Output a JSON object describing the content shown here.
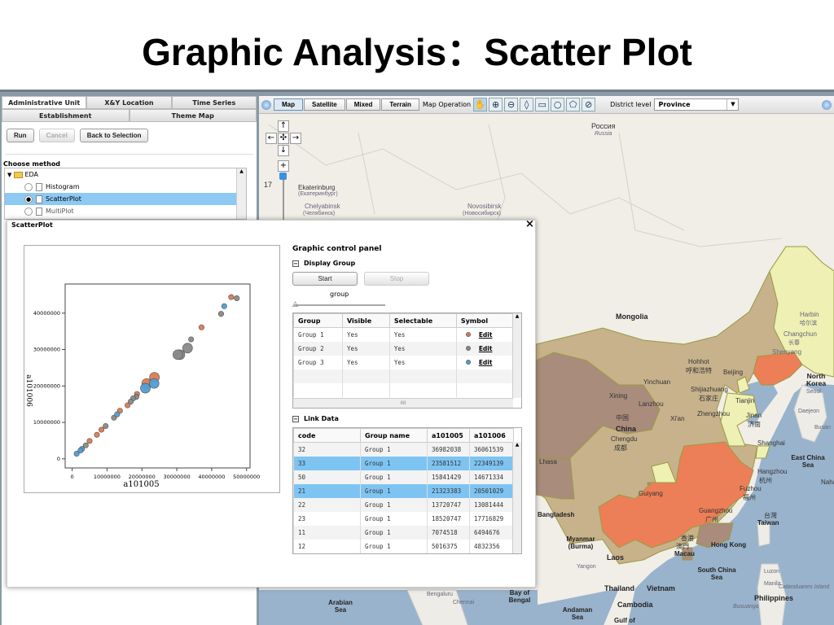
{
  "slide_title": "Graphic Analysis：Scatter Plot",
  "left_panel": {
    "tabs_row1": [
      "Administrative Unit",
      "X&Y Location",
      "Time Series"
    ],
    "tabs_row2": [
      "Establishment",
      "Theme Map"
    ],
    "buttons": {
      "run": "Run",
      "cancel": "Cancel",
      "back": "Back to Selection"
    },
    "choose_method": "Choose method",
    "tree": {
      "folder": "EDA",
      "items": [
        "Histogram",
        "ScatterPlot",
        "MultiPlot"
      ],
      "selected": "ScatterPlot"
    }
  },
  "map": {
    "map_types": [
      "Map",
      "Satellite",
      "Mixed",
      "Terrain"
    ],
    "active_type": "Map",
    "map_operation_label": "Map Operation",
    "tools": [
      "pan-hand",
      "zoom-in",
      "zoom-out",
      "marker",
      "rectangle",
      "circle",
      "polygon",
      "clear"
    ],
    "district_level_label": "District level",
    "district_level_value": "Province",
    "zoom_level": "17",
    "labels": [
      "Россия",
      "Russia",
      "Ekaterinburg",
      "(Екатеринбург)",
      "Chelyabinsk",
      "(Челябинск)",
      "Novosibirsk",
      "(Новосибирск)",
      "Mongolia",
      "Harbin",
      "哈尔滨",
      "Changchun",
      "长春",
      "Shenyang",
      "North Korea",
      "Hohhot",
      "呼和浩特",
      "Beijing",
      "Yinchuan",
      "Shijiazhuang",
      "石家庄",
      "Tianjin",
      "Xining",
      "Lanzhou",
      "Xi'an",
      "Zhengzhou",
      "Jinan",
      "济南",
      "中国",
      "China",
      "Chengdu",
      "成都",
      "Shanghai",
      "East China Sea",
      "Lhasa",
      "Hangzhou",
      "杭州",
      "Naha",
      "Guiyang",
      "Fuzhou",
      "福州",
      "Guangzhou",
      "广州",
      "台灣",
      "Taiwan",
      "Bangladesh",
      "Myanmar (Burma)",
      "香港",
      "Hong Kong",
      "澳門",
      "Macau",
      "Laos",
      "Yangon",
      "South China Sea",
      "Luzon",
      "Manila",
      "Catanduanes Island",
      "Thailand",
      "Vietnam",
      "Philippines",
      "Cambodia",
      "Andaman Sea",
      "Bay of Bengal",
      "Arabian Sea",
      "Gulf of",
      "Busuanga",
      "Bengaluru",
      "Chennai",
      "Seoul",
      "Daejeon",
      "Busan"
    ],
    "colors": {
      "land": "#f1eee8",
      "sea": "#99b3cc",
      "tan": "#c7b28c",
      "brown": "#a98c7c",
      "orange": "#ec7f57",
      "yellow": "#eef0b4"
    }
  },
  "popup": {
    "title": "ScatterPlot",
    "close_icon": "×",
    "control_panel": {
      "title": "Graphic control panel",
      "display_group": "Display Group",
      "start": "Start",
      "stop": "Stop",
      "slider_label": "group",
      "slider_value": 0,
      "group_table": {
        "headers": [
          "Group",
          "Visible",
          "Selectable",
          "Symbol"
        ],
        "rows": [
          {
            "group": "Group 1",
            "visible": "Yes",
            "selectable": "Yes",
            "color": "#e07a50",
            "edit": "Edit"
          },
          {
            "group": "Group 2",
            "visible": "Yes",
            "selectable": "Yes",
            "color": "#8a8a8a",
            "edit": "Edit"
          },
          {
            "group": "Group 3",
            "visible": "Yes",
            "selectable": "Yes",
            "color": "#4f9fd6",
            "edit": "Edit"
          }
        ],
        "hscroll_grip": "IIII"
      },
      "link_data": "Link Data",
      "link_table": {
        "headers": [
          "code",
          "Group name",
          "a101005",
          "a101006"
        ],
        "rows": [
          {
            "code": "32",
            "group": "Group 1",
            "a": "36982038",
            "b": "36061539",
            "selected": false
          },
          {
            "code": "33",
            "group": "Group 1",
            "a": "23581512",
            "b": "22349139",
            "selected": true
          },
          {
            "code": "50",
            "group": "Group 1",
            "a": "15841429",
            "b": "14671334",
            "selected": false
          },
          {
            "code": "21",
            "group": "Group 1",
            "a": "21323383",
            "b": "20501029",
            "selected": true
          },
          {
            "code": "22",
            "group": "Group 1",
            "a": "13720747",
            "b": "13081444",
            "selected": false
          },
          {
            "code": "23",
            "group": "Group 1",
            "a": "18520747",
            "b": "17716829",
            "selected": false
          },
          {
            "code": "11",
            "group": "Group 1",
            "a": "7074518",
            "b": "6494676",
            "selected": false
          },
          {
            "code": "12",
            "group": "Group 1",
            "a": "5016375",
            "b": "4832356",
            "selected": false
          }
        ]
      }
    }
  },
  "chart_data": {
    "type": "scatter",
    "title": "",
    "xlabel": "a101005",
    "ylabel": "a101006",
    "xlim": [
      -2000000,
      51000000
    ],
    "ylim": [
      -2500000,
      48000000
    ],
    "xticks": [
      0,
      10000000,
      20000000,
      30000000,
      40000000,
      50000000
    ],
    "yticks": [
      0,
      10000000,
      20000000,
      30000000,
      40000000
    ],
    "series": [
      {
        "name": "Group 1",
        "color": "#e07a50",
        "points": [
          [
            45.6,
            44.4,
            1
          ],
          [
            37.1,
            36.1,
            1
          ],
          [
            23.6,
            22.4,
            2
          ],
          [
            21.4,
            20.7,
            2
          ],
          [
            18.6,
            17.8,
            1
          ],
          [
            15.9,
            14.7,
            1
          ],
          [
            13.7,
            13.2,
            1
          ],
          [
            8.4,
            8.0,
            1
          ],
          [
            7.1,
            6.6,
            1
          ],
          [
            5.0,
            4.9,
            1
          ]
        ]
      },
      {
        "name": "Group 2",
        "color": "#8a8a8a",
        "points": [
          [
            47.2,
            44.1,
            1
          ],
          [
            42.7,
            39.8,
            1
          ],
          [
            34.1,
            32.8,
            1
          ],
          [
            33.1,
            30.4,
            2
          ],
          [
            30.9,
            28.6,
            2
          ],
          [
            30.3,
            28.6,
            2
          ],
          [
            18.4,
            17.0,
            1
          ],
          [
            17.5,
            16.6,
            1
          ],
          [
            16.8,
            15.7,
            1
          ],
          [
            12.0,
            11.3,
            1
          ],
          [
            9.6,
            9.0,
            1
          ],
          [
            3.9,
            3.7,
            1
          ]
        ]
      },
      {
        "name": "Group 3",
        "color": "#4f9fd6",
        "points": [
          [
            43.6,
            41.9,
            1
          ],
          [
            23.5,
            20.7,
            2
          ],
          [
            21.0,
            19.4,
            2
          ],
          [
            12.9,
            12.2,
            1
          ],
          [
            2.8,
            2.7,
            1
          ],
          [
            2.4,
            2.3,
            1
          ],
          [
            1.3,
            1.4,
            1
          ]
        ]
      }
    ],
    "point_units": "millions; third value = relative marker size"
  }
}
